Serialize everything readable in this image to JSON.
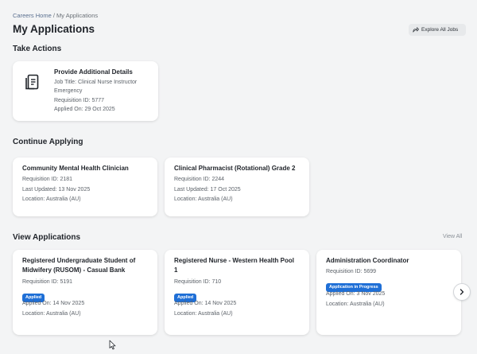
{
  "breadcrumb": {
    "home": "Careers Home",
    "separator": " / ",
    "current": "My Applications"
  },
  "page_title": "My Applications",
  "explore_button": "Explore All Jobs",
  "take_actions": {
    "title": "Take Actions",
    "card": {
      "title": "Provide Additional Details",
      "job_title_line1": "Job Title: Clinical Nurse Instructor",
      "job_title_line2": "Emergency",
      "requisition": "Requisition ID: 5777",
      "applied": "Applied On: 29 Oct 2025",
      "icon": "document-icon"
    }
  },
  "continue_applying": {
    "title": "Continue Applying",
    "cards": [
      {
        "title": "Community Mental Health Clinician",
        "requisition": "Requisition ID: 2181",
        "updated": "Last Updated: 13 Nov 2025",
        "location": "Location: Australia (AU)"
      },
      {
        "title": "Clinical Pharmacist (Rotational) Grade 2",
        "requisition": "Requisition ID: 2244",
        "updated": "Last Updated: 17 Oct 2025",
        "location": "Location: Australia (AU)"
      }
    ]
  },
  "view_applications": {
    "title": "View Applications",
    "view_all": "View All",
    "cards": [
      {
        "title_line1": "Registered Undergraduate Student of",
        "title_line2": "Midwifery (RUSOM) - Casual Bank",
        "requisition": "Requisition ID: 5191",
        "status": "Applied",
        "applied": "Applied On: 14 Nov 2025",
        "location": "Location: Australia (AU)"
      },
      {
        "title_line1": "Registered Nurse - Western Health Pool",
        "title_line2": "1",
        "requisition": "Requisition ID: 710",
        "status": "Applied",
        "applied": "Applied On: 14 Nov 2025",
        "location": "Location: Australia (AU)"
      },
      {
        "title_line1": "Administration Coordinator",
        "requisition": "Requisition ID: 5699",
        "status": "Application in Progress",
        "applied": "Applied On: 3 Nov 2025",
        "location": "Location: Australia (AU)"
      }
    ]
  },
  "colors": {
    "accent": "#1f6fd6",
    "background": "#f3f4f5",
    "card": "#ffffff"
  }
}
